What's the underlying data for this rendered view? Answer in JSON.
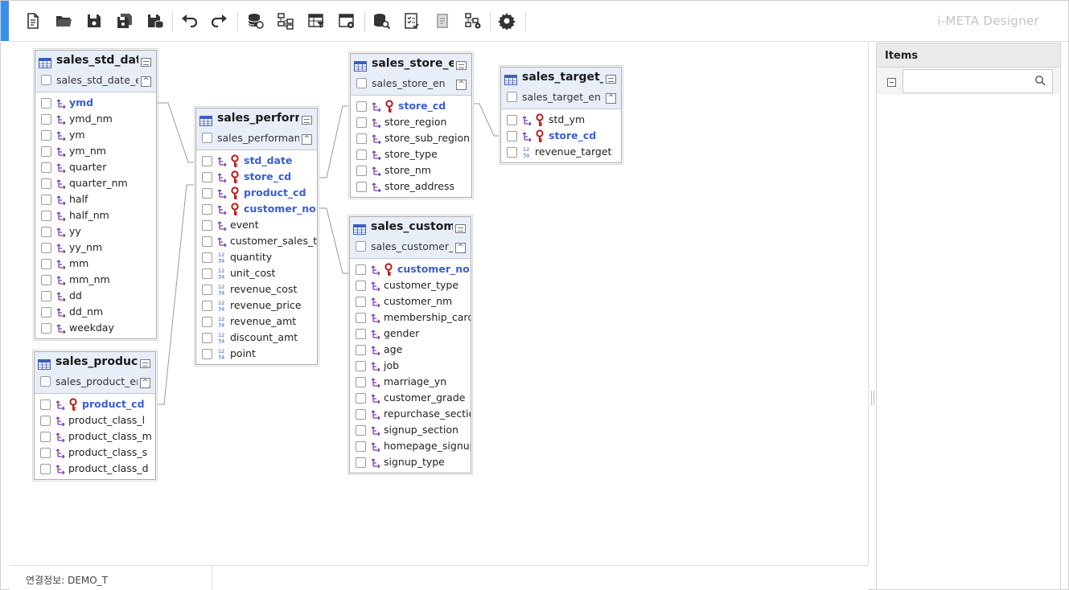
{
  "app": {
    "brand": "i-META Designer"
  },
  "toolbar": {
    "buttons": [
      "new-document",
      "open-folder",
      "save",
      "save-all",
      "save-db",
      "undo",
      "redo",
      "db-link",
      "tree-diagram",
      "table-filter",
      "table-settings",
      "db-search",
      "checklist",
      "document-report",
      "tree-settings",
      "settings"
    ]
  },
  "entities": [
    {
      "title": "sales_std_dat",
      "subtitle": "sales_std_date_e",
      "toggle": "^",
      "columns": [
        {
          "name": "ymd",
          "icon": "fk",
          "pk": false,
          "bold": true
        },
        {
          "name": "ymd_nm",
          "icon": "fk"
        },
        {
          "name": "ym",
          "icon": "fk"
        },
        {
          "name": "ym_nm",
          "icon": "fk"
        },
        {
          "name": "quarter",
          "icon": "fk"
        },
        {
          "name": "quarter_nm",
          "icon": "fk"
        },
        {
          "name": "half",
          "icon": "fk"
        },
        {
          "name": "half_nm",
          "icon": "fk"
        },
        {
          "name": "yy",
          "icon": "fk"
        },
        {
          "name": "yy_nm",
          "icon": "fk"
        },
        {
          "name": "mm",
          "icon": "fk"
        },
        {
          "name": "mm_nm",
          "icon": "fk"
        },
        {
          "name": "dd",
          "icon": "fk"
        },
        {
          "name": "dd_nm",
          "icon": "fk"
        },
        {
          "name": "weekday",
          "icon": "fk"
        }
      ]
    },
    {
      "title": "sales_product",
      "subtitle": "sales_product_en",
      "toggle": "^",
      "columns": [
        {
          "name": "product_cd",
          "icon": "fk",
          "pk": true
        },
        {
          "name": "product_class_l",
          "icon": "fk"
        },
        {
          "name": "product_class_m",
          "icon": "fk"
        },
        {
          "name": "product_class_s",
          "icon": "fk"
        },
        {
          "name": "product_class_d",
          "icon": "fk"
        }
      ]
    },
    {
      "title": "sales_perform",
      "subtitle": "sales_performanc",
      "toggle": "^",
      "columns": [
        {
          "name": "std_date",
          "icon": "fk",
          "pk": true
        },
        {
          "name": "store_cd",
          "icon": "fk",
          "pk": true
        },
        {
          "name": "product_cd",
          "icon": "fk",
          "pk": true
        },
        {
          "name": "customer_no",
          "icon": "fk",
          "pk": true
        },
        {
          "name": "event",
          "icon": "fk"
        },
        {
          "name": "customer_sales_ti",
          "icon": "fk"
        },
        {
          "name": "quantity",
          "icon": "num"
        },
        {
          "name": "unit_cost",
          "icon": "num"
        },
        {
          "name": "revenue_cost",
          "icon": "num"
        },
        {
          "name": "revenue_price",
          "icon": "num"
        },
        {
          "name": "revenue_amt",
          "icon": "num"
        },
        {
          "name": "discount_amt",
          "icon": "num"
        },
        {
          "name": "point",
          "icon": "num"
        }
      ]
    },
    {
      "title": "sales_store_e",
      "subtitle": "sales_store_en",
      "toggle": "^",
      "columns": [
        {
          "name": "store_cd",
          "icon": "fk",
          "pk": true
        },
        {
          "name": "store_region",
          "icon": "fk"
        },
        {
          "name": "store_sub_region",
          "icon": "fk"
        },
        {
          "name": "store_type",
          "icon": "fk"
        },
        {
          "name": "store_nm",
          "icon": "fk"
        },
        {
          "name": "store_address",
          "icon": "fk"
        }
      ]
    },
    {
      "title": "sales_custom",
      "subtitle": "sales_customer_e",
      "toggle": "^",
      "columns": [
        {
          "name": "customer_no",
          "icon": "fk",
          "pk": true
        },
        {
          "name": "customer_type",
          "icon": "fk"
        },
        {
          "name": "customer_nm",
          "icon": "fk"
        },
        {
          "name": "membership_card",
          "icon": "fk"
        },
        {
          "name": "gender",
          "icon": "fk"
        },
        {
          "name": "age",
          "icon": "fk"
        },
        {
          "name": "job",
          "icon": "fk"
        },
        {
          "name": "marriage_yn",
          "icon": "fk"
        },
        {
          "name": "customer_grade",
          "icon": "fk"
        },
        {
          "name": "repurchase_sectio",
          "icon": "fk"
        },
        {
          "name": "signup_section",
          "icon": "fk"
        },
        {
          "name": "homepage_signup",
          "icon": "fk"
        },
        {
          "name": "signup_type",
          "icon": "fk"
        }
      ]
    },
    {
      "title": "sales_target_e",
      "subtitle": "sales_target_en",
      "toggle": "^",
      "columns": [
        {
          "name": "std_ym",
          "icon": "fk",
          "pk": true,
          "plain": true
        },
        {
          "name": "store_cd",
          "icon": "fk",
          "pk": true
        },
        {
          "name": "revenue_target",
          "icon": "num"
        }
      ]
    }
  ],
  "status": {
    "label": "연결정보: DEMO_T"
  },
  "panel": {
    "title": "Items",
    "search_placeholder": ""
  }
}
